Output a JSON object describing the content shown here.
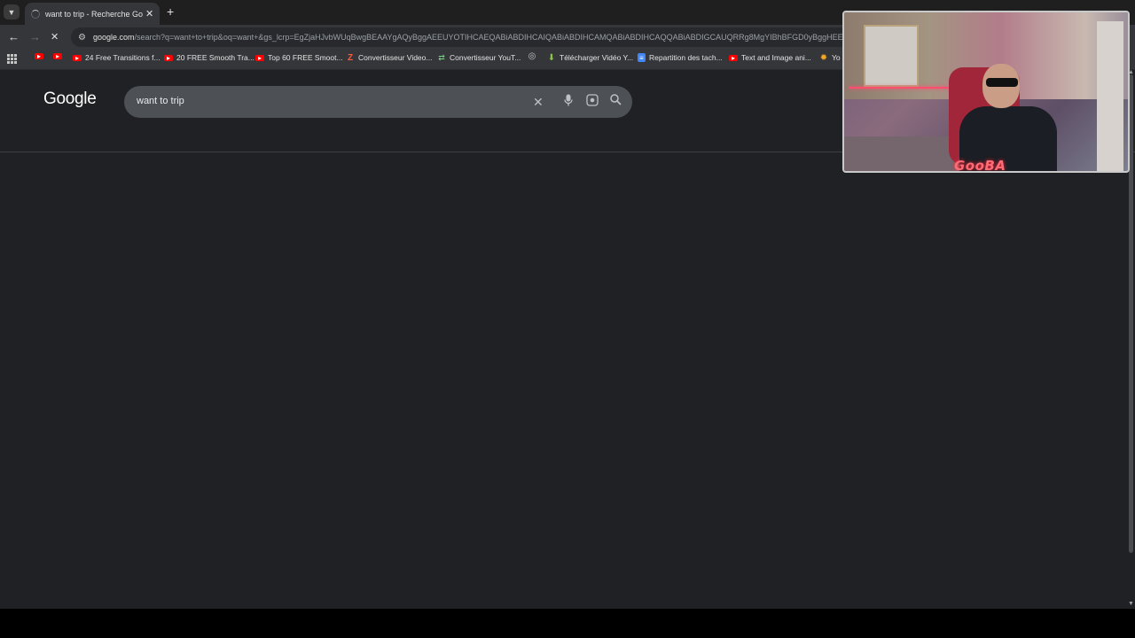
{
  "browser": {
    "tab": {
      "title": "want to trip - Recherche Google",
      "close": "✕"
    },
    "new_tab": "+",
    "toolbar": {
      "back": "←",
      "forward": "→",
      "stop": "✕"
    },
    "address": {
      "host": "google.com",
      "path": "/search?q=want+to+trip&oq=want+&gs_lcrp=EgZjaHJvbWUqBwgBEAAYgAQyBggAEEUYOTIHCAEQABiABDIHCAIQABiABDIHCAMQABiABDIHCAQQABiABDIGCAUQRRg8MgYIBhBFGD0yBggHEE"
    },
    "bookmarks": [
      {
        "label": "",
        "icon": "youtube-icon"
      },
      {
        "label": "",
        "icon": "youtube-icon"
      },
      {
        "label": "24 Free Transitions f...",
        "icon": "youtube-icon"
      },
      {
        "label": "20 FREE Smooth Tra...",
        "icon": "youtube-icon"
      },
      {
        "label": "Top 60 FREE Smoot...",
        "icon": "youtube-icon"
      },
      {
        "label": "Convertisseur Video...",
        "icon": "z-icon"
      },
      {
        "label": "Convertisseur YouT...",
        "icon": "converter-icon"
      },
      {
        "label": "",
        "icon": "globe-icon"
      },
      {
        "label": "Télécharger Vidéo Y...",
        "icon": "download-icon"
      },
      {
        "label": "Repartition des tach...",
        "icon": "docs-icon"
      },
      {
        "label": "Text and Image ani...",
        "icon": "youtube-icon"
      },
      {
        "label": "Yo",
        "icon": "orange-icon"
      }
    ]
  },
  "google": {
    "logo": "Google",
    "query": "want to trip"
  },
  "webcam": {
    "streamer_name": "GooBA"
  },
  "colors": {
    "page_bg": "#202124",
    "searchbox_bg": "#4d5156",
    "youtube_red": "#ff0000",
    "streamer_text": "#ff6b74"
  }
}
